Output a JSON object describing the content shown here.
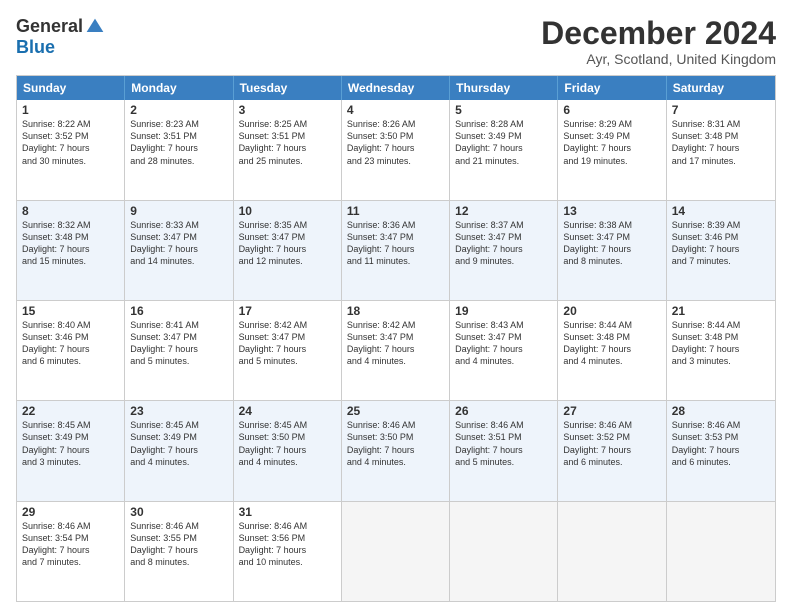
{
  "logo": {
    "general": "General",
    "blue": "Blue"
  },
  "title": "December 2024",
  "location": "Ayr, Scotland, United Kingdom",
  "days": [
    "Sunday",
    "Monday",
    "Tuesday",
    "Wednesday",
    "Thursday",
    "Friday",
    "Saturday"
  ],
  "rows": [
    [
      {
        "day": "1",
        "sunrise": "8:22 AM",
        "sunset": "3:52 PM",
        "daylight": "7 hours and 30 minutes."
      },
      {
        "day": "2",
        "sunrise": "8:23 AM",
        "sunset": "3:51 PM",
        "daylight": "7 hours and 28 minutes."
      },
      {
        "day": "3",
        "sunrise": "8:25 AM",
        "sunset": "3:51 PM",
        "daylight": "7 hours and 25 minutes."
      },
      {
        "day": "4",
        "sunrise": "8:26 AM",
        "sunset": "3:50 PM",
        "daylight": "7 hours and 23 minutes."
      },
      {
        "day": "5",
        "sunrise": "8:28 AM",
        "sunset": "3:49 PM",
        "daylight": "7 hours and 21 minutes."
      },
      {
        "day": "6",
        "sunrise": "8:29 AM",
        "sunset": "3:49 PM",
        "daylight": "7 hours and 19 minutes."
      },
      {
        "day": "7",
        "sunrise": "8:31 AM",
        "sunset": "3:48 PM",
        "daylight": "7 hours and 17 minutes."
      }
    ],
    [
      {
        "day": "8",
        "sunrise": "8:32 AM",
        "sunset": "3:48 PM",
        "daylight": "7 hours and 15 minutes."
      },
      {
        "day": "9",
        "sunrise": "8:33 AM",
        "sunset": "3:47 PM",
        "daylight": "7 hours and 14 minutes."
      },
      {
        "day": "10",
        "sunrise": "8:35 AM",
        "sunset": "3:47 PM",
        "daylight": "7 hours and 12 minutes."
      },
      {
        "day": "11",
        "sunrise": "8:36 AM",
        "sunset": "3:47 PM",
        "daylight": "7 hours and 11 minutes."
      },
      {
        "day": "12",
        "sunrise": "8:37 AM",
        "sunset": "3:47 PM",
        "daylight": "7 hours and 9 minutes."
      },
      {
        "day": "13",
        "sunrise": "8:38 AM",
        "sunset": "3:47 PM",
        "daylight": "7 hours and 8 minutes."
      },
      {
        "day": "14",
        "sunrise": "8:39 AM",
        "sunset": "3:46 PM",
        "daylight": "7 hours and 7 minutes."
      }
    ],
    [
      {
        "day": "15",
        "sunrise": "8:40 AM",
        "sunset": "3:46 PM",
        "daylight": "7 hours and 6 minutes."
      },
      {
        "day": "16",
        "sunrise": "8:41 AM",
        "sunset": "3:47 PM",
        "daylight": "7 hours and 5 minutes."
      },
      {
        "day": "17",
        "sunrise": "8:42 AM",
        "sunset": "3:47 PM",
        "daylight": "7 hours and 5 minutes."
      },
      {
        "day": "18",
        "sunrise": "8:42 AM",
        "sunset": "3:47 PM",
        "daylight": "7 hours and 4 minutes."
      },
      {
        "day": "19",
        "sunrise": "8:43 AM",
        "sunset": "3:47 PM",
        "daylight": "7 hours and 4 minutes."
      },
      {
        "day": "20",
        "sunrise": "8:44 AM",
        "sunset": "3:48 PM",
        "daylight": "7 hours and 4 minutes."
      },
      {
        "day": "21",
        "sunrise": "8:44 AM",
        "sunset": "3:48 PM",
        "daylight": "7 hours and 3 minutes."
      }
    ],
    [
      {
        "day": "22",
        "sunrise": "8:45 AM",
        "sunset": "3:49 PM",
        "daylight": "7 hours and 3 minutes."
      },
      {
        "day": "23",
        "sunrise": "8:45 AM",
        "sunset": "3:49 PM",
        "daylight": "7 hours and 4 minutes."
      },
      {
        "day": "24",
        "sunrise": "8:45 AM",
        "sunset": "3:50 PM",
        "daylight": "7 hours and 4 minutes."
      },
      {
        "day": "25",
        "sunrise": "8:46 AM",
        "sunset": "3:50 PM",
        "daylight": "7 hours and 4 minutes."
      },
      {
        "day": "26",
        "sunrise": "8:46 AM",
        "sunset": "3:51 PM",
        "daylight": "7 hours and 5 minutes."
      },
      {
        "day": "27",
        "sunrise": "8:46 AM",
        "sunset": "3:52 PM",
        "daylight": "7 hours and 6 minutes."
      },
      {
        "day": "28",
        "sunrise": "8:46 AM",
        "sunset": "3:53 PM",
        "daylight": "7 hours and 6 minutes."
      }
    ],
    [
      {
        "day": "29",
        "sunrise": "8:46 AM",
        "sunset": "3:54 PM",
        "daylight": "7 hours and 7 minutes."
      },
      {
        "day": "30",
        "sunrise": "8:46 AM",
        "sunset": "3:55 PM",
        "daylight": "7 hours and 8 minutes."
      },
      {
        "day": "31",
        "sunrise": "8:46 AM",
        "sunset": "3:56 PM",
        "daylight": "7 hours and 10 minutes."
      },
      null,
      null,
      null,
      null
    ]
  ]
}
